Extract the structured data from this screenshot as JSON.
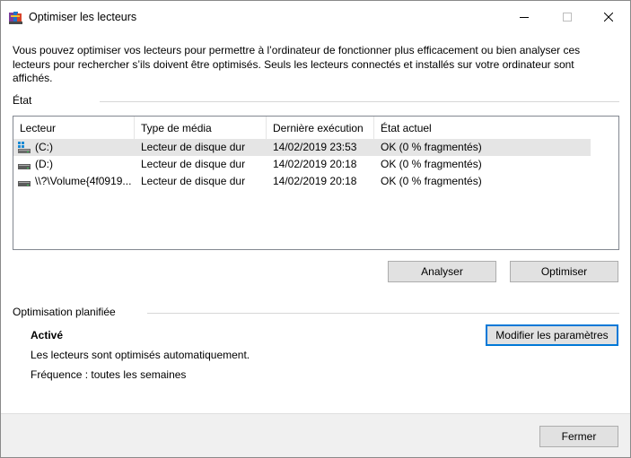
{
  "window": {
    "title": "Optimiser les lecteurs"
  },
  "description": "Vous pouvez optimiser vos lecteurs pour permettre à l’ordinateur de fonctionner plus efficacement ou bien analyser ces lecteurs pour rechercher s’ils doivent être optimisés. Seuls les lecteurs connectés et installés sur votre ordinateur sont affichés.",
  "status_section": {
    "label": "État",
    "columns": [
      "Lecteur",
      "Type de média",
      "Dernière exécution",
      "État actuel"
    ],
    "rows": [
      {
        "drive": "(C:)",
        "media": "Lecteur de disque dur",
        "last_run": "14/02/2019 23:53",
        "state": "OK (0 % fragmentés)",
        "icon": "system-drive-icon",
        "selected": true
      },
      {
        "drive": "(D:)",
        "media": "Lecteur de disque dur",
        "last_run": "14/02/2019 20:18",
        "state": "OK (0 % fragmentés)",
        "icon": "hard-drive-icon",
        "selected": false
      },
      {
        "drive": "\\\\?\\Volume{4f0919...",
        "media": "Lecteur de disque dur",
        "last_run": "14/02/2019 20:18",
        "state": "OK (0 % fragmentés)",
        "icon": "hard-drive-icon",
        "selected": false
      }
    ]
  },
  "buttons": {
    "analyze": "Analyser",
    "optimize": "Optimiser",
    "change_settings": "Modifier les paramètres",
    "close": "Fermer"
  },
  "schedule": {
    "label": "Optimisation planifiée",
    "status": "Activé",
    "line1": "Les lecteurs sont optimisés automatiquement.",
    "line2": "Fréquence : toutes les semaines"
  },
  "colors": {
    "accent": "#0078d7",
    "selected_row": "#e5e5e5",
    "button_face": "#e1e1e1"
  }
}
